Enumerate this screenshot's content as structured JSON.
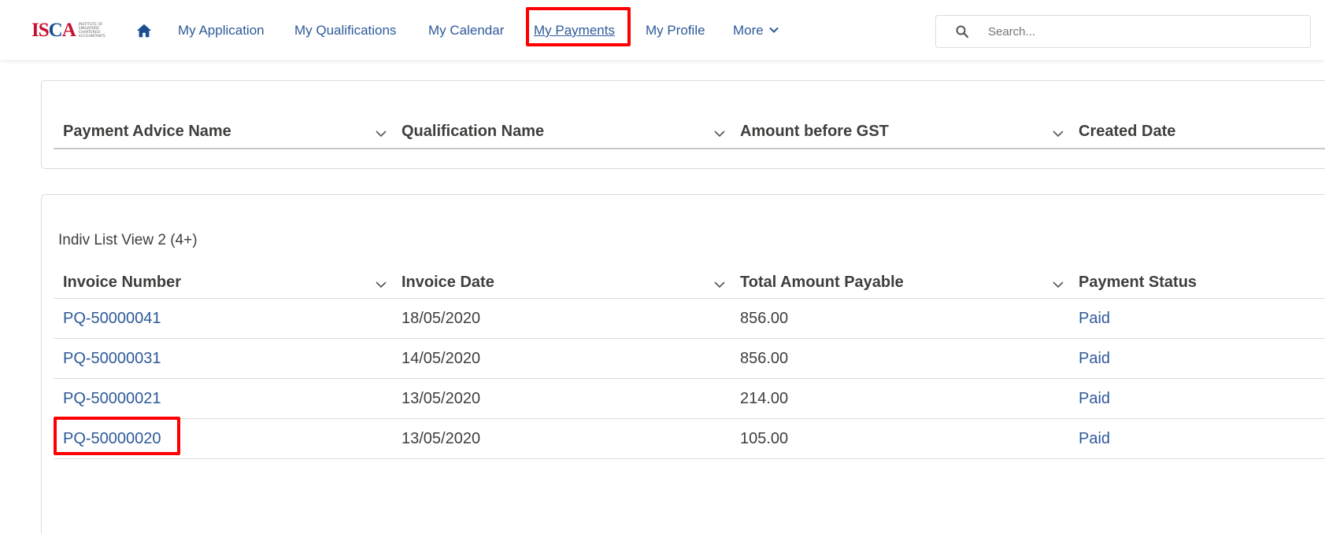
{
  "brand": {
    "logo_text_left": "IS",
    "logo_text_ring": "C",
    "logo_text_right": "A",
    "logo_subtext": "Institute of Singapore Chartered Accountants",
    "accent_red": "#c8102e",
    "accent_blue": "#1a4e91"
  },
  "nav": {
    "home_icon": "home-icon",
    "items": [
      {
        "label": "My Application"
      },
      {
        "label": "My Qualifications"
      },
      {
        "label": "My Calendar"
      },
      {
        "label": "My Payments",
        "active": true
      },
      {
        "label": "My Profile"
      },
      {
        "label": "More"
      }
    ],
    "link_color": "#2e5a99"
  },
  "search": {
    "placeholder": "Search..."
  },
  "payment_advice_table": {
    "columns": [
      {
        "label": "Payment Advice Name"
      },
      {
        "label": "Qualification Name"
      },
      {
        "label": "Amount before GST"
      },
      {
        "label": "Created Date"
      }
    ]
  },
  "invoice_list": {
    "title": "Indiv List View 2 (4+)",
    "columns": [
      {
        "label": "Invoice Number"
      },
      {
        "label": "Invoice Date"
      },
      {
        "label": "Total Amount Payable"
      },
      {
        "label": "Payment Status"
      }
    ],
    "rows": [
      {
        "invoice_number": "PQ-50000041",
        "invoice_date": "18/05/2020",
        "total_amount": "856.00",
        "status": "Paid"
      },
      {
        "invoice_number": "PQ-50000031",
        "invoice_date": "14/05/2020",
        "total_amount": "856.00",
        "status": "Paid"
      },
      {
        "invoice_number": "PQ-50000021",
        "invoice_date": "13/05/2020",
        "total_amount": "214.00",
        "status": "Paid"
      },
      {
        "invoice_number": "PQ-50000020",
        "invoice_date": "13/05/2020",
        "total_amount": "105.00",
        "status": "Paid"
      }
    ]
  },
  "annotation_color": "#ff0000"
}
